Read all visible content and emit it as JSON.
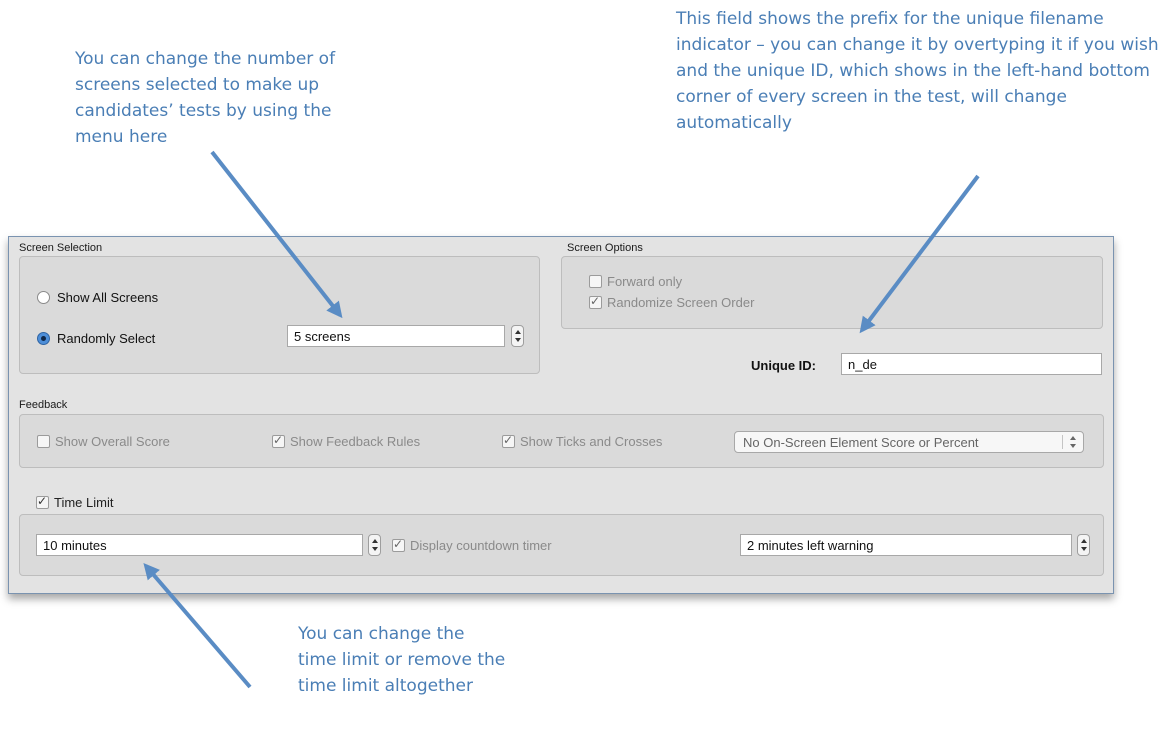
{
  "callouts": {
    "screens": "You can change the number of screens selected to make up candidates’ tests by using the menu here",
    "unique_id": "This field shows the prefix for the unique filename indicator – you can change it by overtyping it if you wish and the unique ID, which shows in the left-hand bottom corner of every screen in the test, will change automatically",
    "time": "You can change the time limit or remove the time limit altogether"
  },
  "colors": {
    "callout": "#4a7eb5",
    "arrow": "#5a8cc4",
    "panel": "#e3e3e3",
    "radio_selected": "#4d8ed8"
  },
  "screen_selection": {
    "label": "Screen Selection",
    "show_all_label": "Show All Screens",
    "show_all_selected": false,
    "randomly_label": "Randomly Select",
    "randomly_selected": true,
    "count_value": "5 screens"
  },
  "screen_options": {
    "label": "Screen Options",
    "forward_only_label": "Forward only",
    "forward_only_checked": false,
    "randomize_label": "Randomize Screen Order",
    "randomize_checked": true
  },
  "unique_id": {
    "label": "Unique ID:",
    "value": "n_de"
  },
  "feedback": {
    "label": "Feedback",
    "overall_score_label": "Show Overall Score",
    "overall_score_checked": false,
    "feedback_rules_label": "Show Feedback Rules",
    "feedback_rules_checked": true,
    "ticks_label": "Show Ticks and Crosses",
    "ticks_checked": true,
    "element_score_value": "No On-Screen Element Score or Percent"
  },
  "time_limit": {
    "label": "Time Limit",
    "checked": true,
    "value": "10 minutes",
    "countdown_label": "Display countdown timer",
    "countdown_checked": true,
    "warning_value": "2 minutes left warning"
  }
}
